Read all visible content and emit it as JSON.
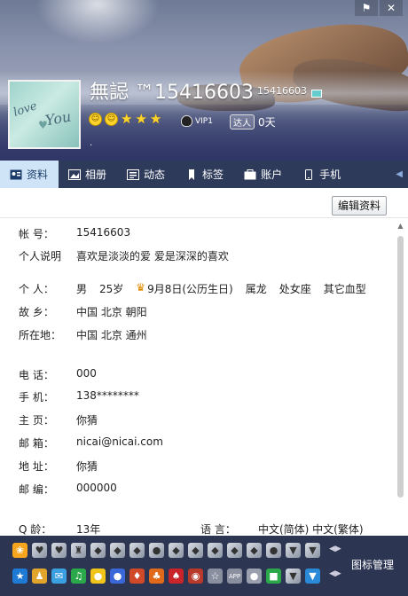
{
  "header": {
    "nickname": "無誋 ™15416603",
    "qq_number": "15416603",
    "vip_label": "VIP1",
    "daren_tag": "达人",
    "daren_days": "0天",
    "signature": "."
  },
  "tabs": [
    {
      "label": "资料",
      "icon": "profile-card-icon",
      "active": true
    },
    {
      "label": "相册",
      "icon": "photo-album-icon"
    },
    {
      "label": "动态",
      "icon": "feed-icon"
    },
    {
      "label": "标签",
      "icon": "bookmark-tag-icon"
    },
    {
      "label": "账户",
      "icon": "wallet-icon"
    },
    {
      "label": "手机",
      "icon": "phone-icon"
    }
  ],
  "toolbar": {
    "edit_label": "编辑资料"
  },
  "profile": {
    "account": {
      "label": "帐  号：",
      "value": "15416603"
    },
    "bio": {
      "label": "个人说明",
      "value": "喜欢是淡淡的爱 爱是深深的喜欢"
    },
    "personal": {
      "label": "个  人：",
      "gender": "男",
      "age": "25岁",
      "birthday": "9月8日(公历生日)",
      "zodiac": "属龙",
      "constellation": "处女座",
      "blood": "其它血型"
    },
    "hometown": {
      "label": "故  乡：",
      "value": "中国 北京 朝阳"
    },
    "location": {
      "label": "所在地：",
      "value": "中国 北京 通州"
    },
    "phone": {
      "label": "电  话：",
      "value": "000"
    },
    "mobile": {
      "label": "手  机：",
      "value": "138********"
    },
    "homepage": {
      "label": "主  页：",
      "value": "你猜"
    },
    "email": {
      "label": "邮  箱：",
      "value": "nicai@nicai.com"
    },
    "address": {
      "label": "地  址：",
      "value": "你猜"
    },
    "zipcode": {
      "label": "邮  编：",
      "value": "000000"
    },
    "qage": {
      "label": "Q  龄：",
      "value": "13年"
    },
    "language": {
      "label": "语  言：",
      "value": "中文(简体) 中文(繁体)"
    }
  },
  "bottom": {
    "manage_label": "图标管理",
    "row1_icons": [
      "flame-icon",
      "heart-icon",
      "heart-icon",
      "trophy-icon",
      "diamond-icon",
      "diamond-icon",
      "diamond-icon",
      "penguin-icon",
      "diamond-icon",
      "diamond-icon",
      "diamond-icon",
      "diamond-icon",
      "diamond-icon",
      "penguin-icon",
      "shield-icon",
      "shield-icon"
    ],
    "row2_icons": [
      "qzone-icon",
      "game-icon",
      "mail-icon",
      "music-icon",
      "pet-icon",
      "penguin-icon",
      "game-icon",
      "game-icon",
      "game-icon",
      "game-icon",
      "star-icon",
      "app-icon",
      "bubble-icon",
      "game-icon",
      "shield-icon",
      "shield-icon"
    ]
  },
  "colors": {
    "tab_bar": "#2e3a5a",
    "tab_active": "#cfe4f6",
    "bottom_bar": "#2c3552"
  }
}
